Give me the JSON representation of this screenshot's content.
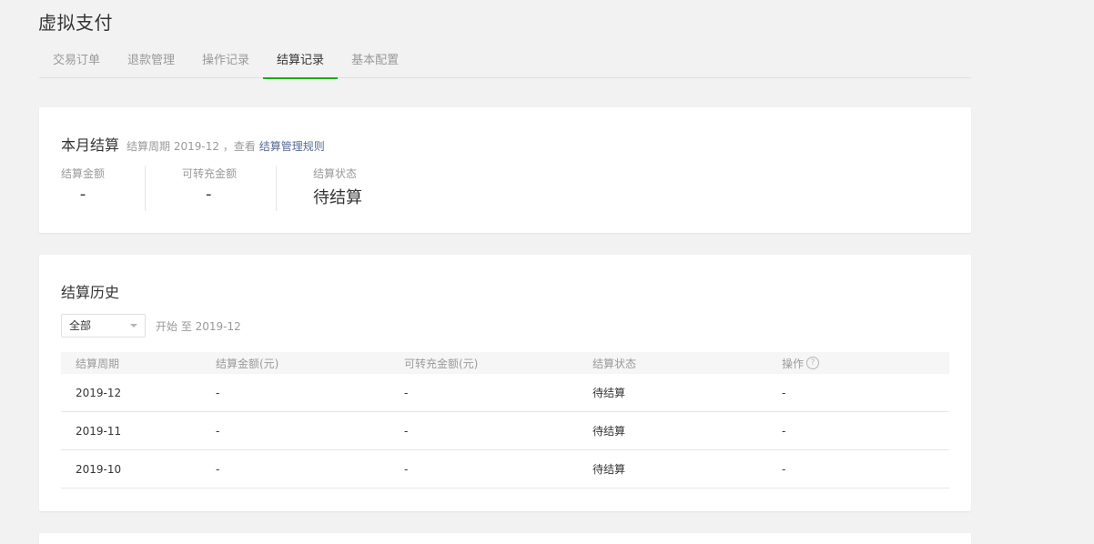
{
  "page": {
    "title": "虚拟支付"
  },
  "tabs": [
    {
      "label": "交易订单"
    },
    {
      "label": "退款管理"
    },
    {
      "label": "操作记录"
    },
    {
      "label": "结算记录"
    },
    {
      "label": "基本配置"
    }
  ],
  "current_month": {
    "title": "本月结算",
    "period_text": "结算周期 2019-12 ，查看",
    "rules_link": "结算管理规则",
    "amount_label": "结算金额",
    "amount_value": "-",
    "transferable_label": "可转充金额",
    "transferable_value": "-",
    "status_label": "结算状态",
    "status_value": "待结算"
  },
  "history": {
    "title": "结算历史",
    "filter_value": "全部",
    "range_text": "开始 至 2019-12",
    "columns": [
      "结算周期",
      "结算金额(元)",
      "可转充金额(元)",
      "结算状态",
      "操作"
    ],
    "help_glyph": "?",
    "rows": [
      {
        "period": "2019-12",
        "amount": "-",
        "transferable": "-",
        "status": "待结算",
        "action": "-"
      },
      {
        "period": "2019-11",
        "amount": "-",
        "transferable": "-",
        "status": "待结算",
        "action": "-"
      },
      {
        "period": "2019-10",
        "amount": "-",
        "transferable": "-",
        "status": "待结算",
        "action": "-"
      }
    ]
  },
  "colors": {
    "accent": "#1aad19",
    "link": "#576b95",
    "text": "#353535",
    "muted": "#9a9a9a",
    "background": "#f2f2f2"
  },
  "icons": {
    "select_arrow": "caret-down-icon",
    "help": "question-circle-icon"
  }
}
